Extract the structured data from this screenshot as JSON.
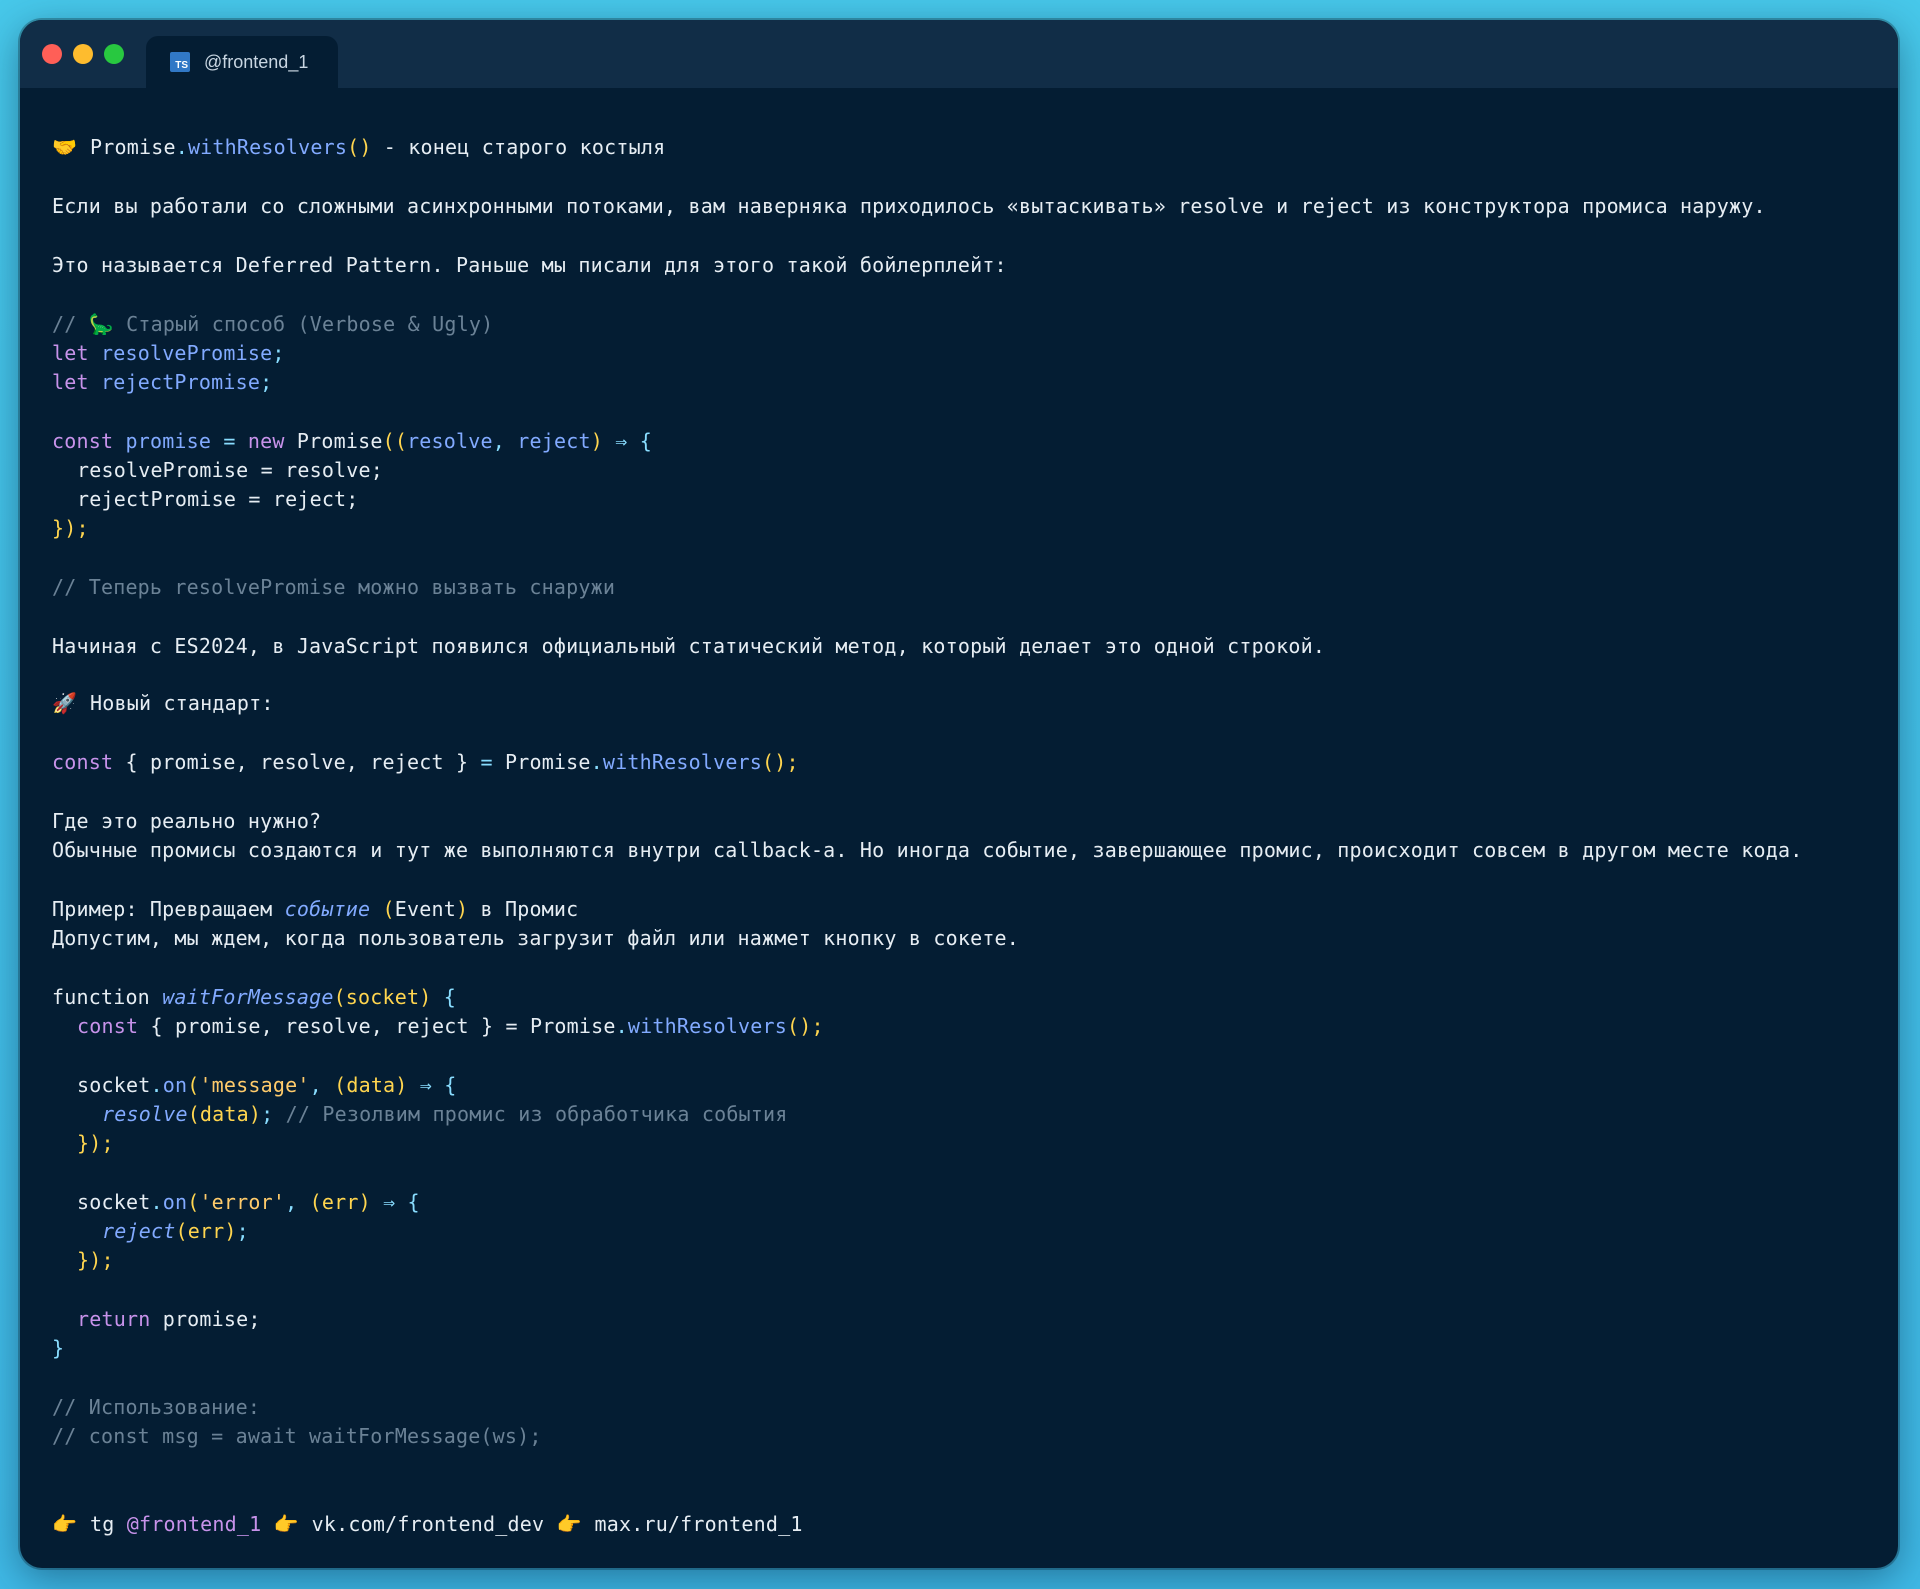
{
  "window": {
    "tab": {
      "icon": "typescript-icon",
      "label": "@frontend_1"
    }
  },
  "post": {
    "title": {
      "emoji": "🤝",
      "code_obj": "Promise",
      "code_dot": ".",
      "code_method": "withResolvers",
      "code_parens": "()",
      "rest": " - конец старого костыля"
    },
    "intro": "Если вы работали со сложными асинхронными потоками, вам наверняка приходилось «вытаскивать» resolve и reject из конструктора промиса наружу.",
    "deferred": "Это называется Deferred Pattern. Раньше мы писали для этого такой бойлерплейт:",
    "old_comment": {
      "slash": "//",
      "emoji": "🦕",
      "text": "Старый способ (Verbose & Ugly)"
    },
    "old_code": {
      "let1_kw": "let",
      "let1_var": "resolvePromise",
      "let1_semi": ";",
      "let2_kw": "let",
      "let2_var": "rejectPromise",
      "let2_semi": ";",
      "const_kw": "const",
      "promise_var": "promise",
      "eq": "=",
      "new_kw": "new",
      "promise_cls": "Promise",
      "open_paren": "((",
      "arg1": "resolve",
      "comma": ",",
      "arg2": "reject",
      "close_paren": ")",
      "arrow": "⇒",
      "brace": "{",
      "body1": "resolvePromise = resolve;",
      "body2": "rejectPromise = reject;",
      "close": "});"
    },
    "now_comment": "// Теперь resolvePromise можно вызвать снаружи",
    "es2024": "Начиная с ES2024, в JavaScript появился официальный статический метод, который делает это одной строкой.",
    "new_standard": {
      "emoji": "🚀",
      "text": "Новый стандарт:"
    },
    "new_code": {
      "kw": "const",
      "destructure": "{ promise, resolve, reject }",
      "eq": "=",
      "obj": "Promise",
      "dot": ".",
      "method": "withResolvers",
      "call": "();"
    },
    "where_q": "Где это реально нужно?",
    "where_a": "Обычные промисы создаются и тут же выполняются внутри callback-а. Но иногда событие, завершающее промис, происходит совсем в другом месте кода.",
    "example": {
      "prefix": "Пример: Превращаем ",
      "event_it": "событие",
      "paren_open": " (",
      "event_word": "Event",
      "paren_close": ")",
      "suffix": " в Промис"
    },
    "example_desc": "Допустим, мы ждем, когда пользователь загрузит файл или нажмет кнопку в сокете.",
    "fn_code": {
      "fn_kw": "function",
      "fn_name": "waitForMessage",
      "fn_params": "(socket)",
      "fn_brace": " {",
      "line2_kw": "const",
      "line2_rest": "{ promise, resolve, reject } =",
      "line2_obj": "Promise",
      "line2_method": "withResolvers",
      "line2_call": "();",
      "on1_obj": "socket",
      "on1_method": "on",
      "on1_str": "'message'",
      "on1_args": "(data)",
      "on1_arrow": "⇒ {",
      "resolve_call": "resolve",
      "resolve_arg": "(data)",
      "resolve_semi": ";",
      "resolve_comment": "// Резолвим промис из обработчика события",
      "close1": "});",
      "on2_obj": "socket",
      "on2_method": "on",
      "on2_str": "'error'",
      "on2_args": "(err)",
      "on2_arrow": "⇒ {",
      "reject_call": "reject",
      "reject_arg": "(err)",
      "reject_semi": ";",
      "close2": "});",
      "return_kw": "return",
      "return_val": "promise;",
      "fn_close": "}"
    },
    "usage_comment1": "// Использование:",
    "usage_comment2": "// const msg = await waitForMessage(ws);",
    "footer": {
      "e1": "👉",
      "tg": "tg",
      "tg_handle": "@frontend_1",
      "e2": "👉",
      "vk": "vk.com/frontend_dev",
      "e3": "👉",
      "max": "max.ru/frontend_1"
    }
  }
}
